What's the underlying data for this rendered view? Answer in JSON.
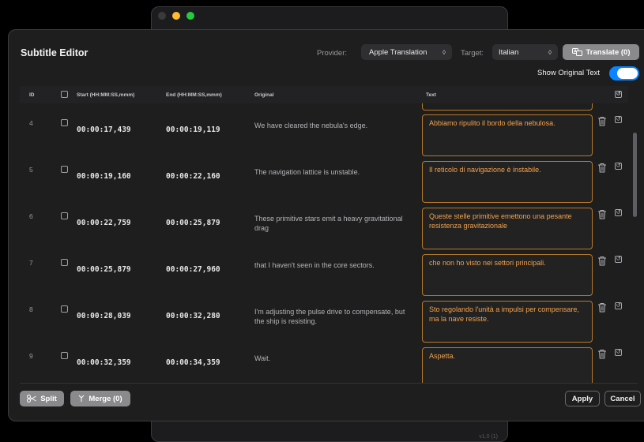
{
  "window": {
    "version": "v1.0 (1)",
    "traffic_lights": [
      "#3a3a3c",
      "#febc2e",
      "#28c840"
    ]
  },
  "editor": {
    "title": "Subtitle Editor",
    "provider_label": "Provider:",
    "provider_value": "Apple Translation",
    "target_label": "Target:",
    "target_value": "Italian",
    "translate_label": "Translate (0)",
    "show_original_label": "Show Original Text",
    "show_original_on": true
  },
  "table": {
    "columns": {
      "id": "ID",
      "start": "Start (HH:MM:SS,mmm)",
      "end": "End (HH:MM:SS,mmm)",
      "original": "Original",
      "text": "Text"
    },
    "rows": [
      {
        "id": "4",
        "start": "00:00:17,439",
        "end": "00:00:19,119",
        "original": "We have cleared the nebula's edge.",
        "text": "Abbiamo ripulito il bordo della nebulosa."
      },
      {
        "id": "5",
        "start": "00:00:19,160",
        "end": "00:00:22,160",
        "original": "The navigation lattice is unstable.",
        "text": "Il reticolo di navigazione è instabile."
      },
      {
        "id": "6",
        "start": "00:00:22,759",
        "end": "00:00:25,879",
        "original": "These primitive stars emit a heavy gravitational drag",
        "text": "Queste stelle primitive emettono una pesante resistenza gravitazionale"
      },
      {
        "id": "7",
        "start": "00:00:25,879",
        "end": "00:00:27,960",
        "original": "that I haven't seen in the core sectors.",
        "text": "che non ho visto nei settori principali."
      },
      {
        "id": "8",
        "start": "00:00:28,039",
        "end": "00:00:32,280",
        "original": "I'm adjusting the pulse drive to compensate, but the ship is resisting.",
        "text": "Sto regolando l'unità a impulsi per compensare, ma la nave resiste."
      },
      {
        "id": "9",
        "start": "00:00:32,359",
        "end": "00:00:34,359",
        "original": "Wait.",
        "text": "Aspetta."
      }
    ]
  },
  "footer": {
    "split_label": "Split",
    "merge_label": "Merge (0)",
    "apply_label": "Apply",
    "cancel_label": "Cancel"
  },
  "colors": {
    "accent": "#0a84ff",
    "translation_text": "#f5a24a",
    "translation_border": "#b87a2a"
  },
  "icons": [
    "scissors-icon",
    "merge-icon",
    "translate-icon",
    "trash-icon",
    "revert-icon",
    "chevron-updown-icon"
  ]
}
